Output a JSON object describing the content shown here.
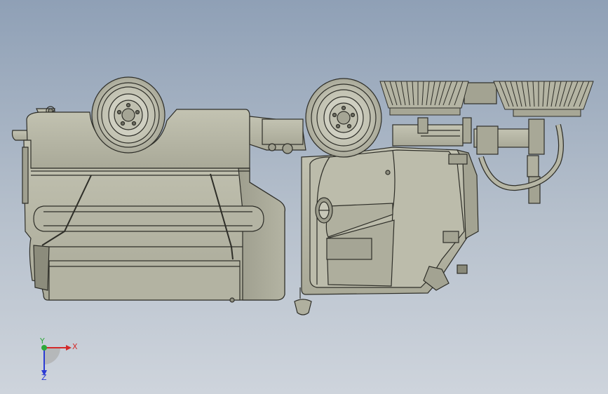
{
  "viewport": {
    "background_top": "#8fa0b6",
    "background_bottom": "#ced4dc"
  },
  "model": {
    "body_color": "#b9b9a8",
    "body_shade": "#a3a392",
    "edge_color": "#2e2e28"
  },
  "triad": {
    "x_label": "X",
    "y_label": "Y",
    "z_label": "Z",
    "x_color": "#d42a2a",
    "y_color": "#2ea83a",
    "z_color": "#2a3ad4"
  }
}
